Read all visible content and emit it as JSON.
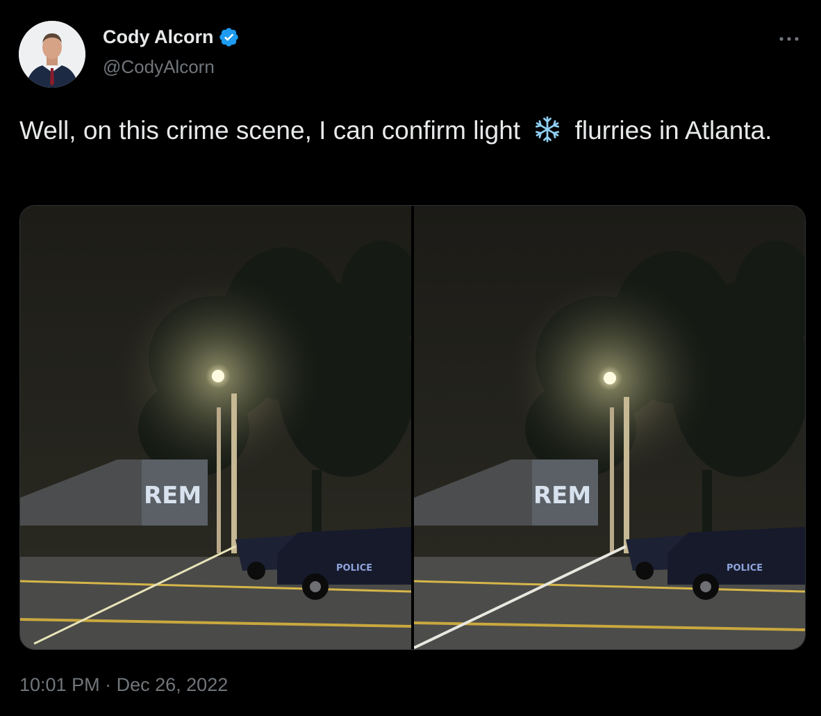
{
  "author": {
    "display_name": "Cody Alcorn",
    "handle": "@CodyAlcorn",
    "verified": true
  },
  "tweet": {
    "text_before_emoji": "Well, on this crime scene, I can confirm light",
    "emoji": "snowflake",
    "text_after_emoji": "flurries in Atlanta."
  },
  "media": {
    "photos": [
      {
        "sign_text": "REM",
        "vehicle_text": "POLICE"
      },
      {
        "sign_text": "REM",
        "vehicle_text": "POLICE"
      }
    ]
  },
  "meta": {
    "time": "10:01 PM",
    "separator": "·",
    "date": "Dec 26, 2022"
  },
  "colors": {
    "background": "#000000",
    "text_primary": "#e7e9ea",
    "text_secondary": "#71767b",
    "verified_blue": "#1d9bf0"
  }
}
